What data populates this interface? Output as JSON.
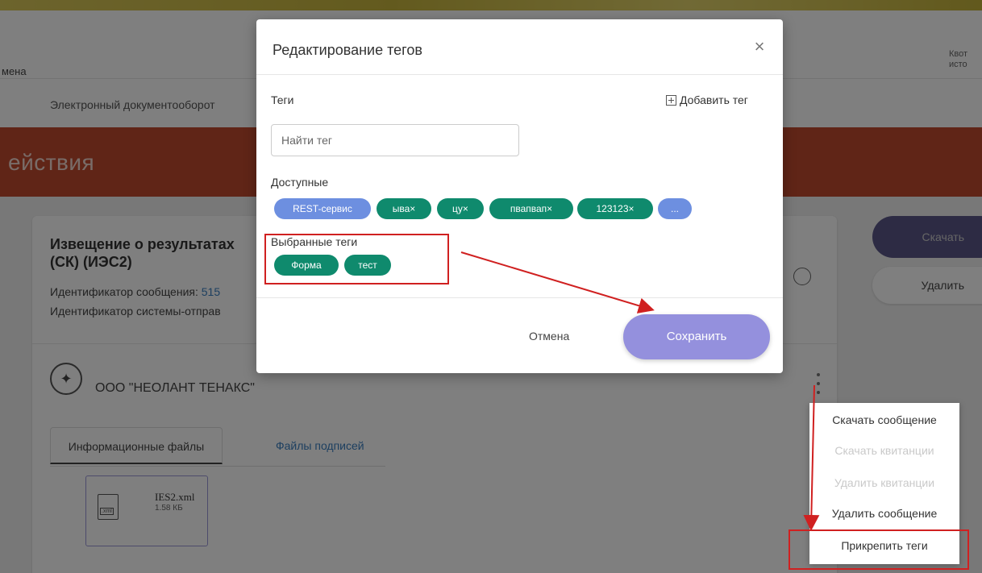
{
  "header": {
    "left_text": "мена",
    "right_text_line1": "Квот",
    "right_text_line2": "исто"
  },
  "subnav": {
    "item": "Электронный документооборот"
  },
  "banner": {
    "title": "ействия"
  },
  "card": {
    "title_line1": "Извещение о результатах",
    "title_line2": "(СК) (ИЭС2)",
    "message_id_label": "Идентификатор сообщения: ",
    "message_id_value": "515",
    "sender_system_label": "Идентификатор системы-отправ",
    "org_name": "ООО \"НЕОЛАНТ ТЕНАКС\"",
    "tabs": [
      {
        "label": "Информационные файлы",
        "active": true
      },
      {
        "label": "Файлы подписей",
        "active": false
      }
    ],
    "file": {
      "name": "IES2.xml",
      "size": "1.58 КБ",
      "icon_label": ".xml"
    }
  },
  "side_buttons": {
    "download": "Скачать",
    "delete": "Удалить"
  },
  "dropdown": {
    "items": [
      {
        "label": "Скачать сообщение",
        "enabled": true
      },
      {
        "label": "Скачать квитанции",
        "enabled": false
      },
      {
        "label": "Удалить квитанции",
        "enabled": false
      },
      {
        "label": "Удалить сообщение",
        "enabled": true
      },
      {
        "label": "Прикрепить теги",
        "enabled": true
      }
    ]
  },
  "modal": {
    "title": "Редактирование тегов",
    "close_glyph": "×",
    "tags_label": "Теги",
    "add_tag": "Добавить тег",
    "search_placeholder": "Найти тег",
    "available_label": "Доступные",
    "available_tags": [
      {
        "label": "REST-сервис",
        "color": "#6d8fe0"
      },
      {
        "label": "ыва×",
        "color": "#0f8a6d"
      },
      {
        "label": "цу×",
        "color": "#0f8a6d"
      },
      {
        "label": "пвапвап×",
        "color": "#0f8a6d"
      },
      {
        "label": "123123×",
        "color": "#0f8a6d"
      },
      {
        "label": "...",
        "color": "#6d8fe0"
      }
    ],
    "selected_label": "Выбранные теги",
    "selected_tags": [
      {
        "label": "Форма",
        "color": "#0f8a6d"
      },
      {
        "label": "тест",
        "color": "#0f8a6d"
      }
    ],
    "cancel": "Отмена",
    "save": "Сохранить"
  },
  "colors": {
    "banner": "#c14a2f",
    "save_button": "#9490dd",
    "tag_green": "#0f8a6d",
    "tag_blue": "#6d8fe0",
    "annotation_red": "#d02020"
  }
}
